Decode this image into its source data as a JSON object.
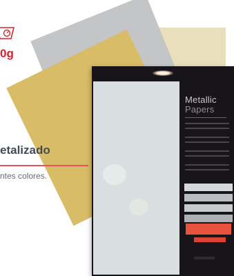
{
  "product": {
    "weight": "0g",
    "title": "etalizado",
    "description": "ntes colores."
  },
  "booklet": {
    "brand_line1": "Metallic",
    "brand_line2": "Papers"
  },
  "colors": {
    "accent_red": "#d32430",
    "sheet_gold": "#d9bc68",
    "sheet_grey": "#c3c5c6",
    "sheet_cream": "#e9dfbb",
    "booklet_dark": "#17141a",
    "booklet_red": "#e8533d"
  },
  "icons": [
    "weight-scale-icon"
  ]
}
